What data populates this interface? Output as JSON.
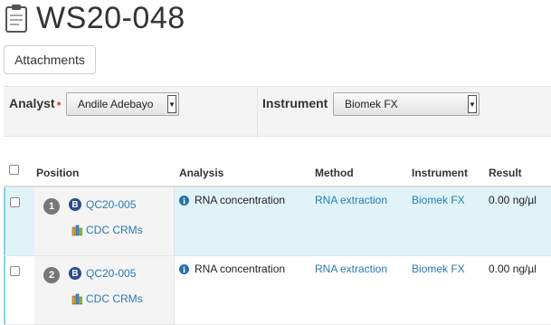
{
  "page": {
    "title": "WS20-048",
    "icon": "clipboard-icon"
  },
  "toolbar": {
    "attachments_label": "Attachments"
  },
  "filters": {
    "analyst_label": "Analyst",
    "analyst_required_marker": "•",
    "analyst_value": "Andile Adebayo",
    "instrument_label": "Instrument",
    "instrument_value": "Biomek FX"
  },
  "table": {
    "headers": {
      "position": "Position",
      "analysis": "Analysis",
      "method": "Method",
      "instrument": "Instrument",
      "result": "Result"
    },
    "rows": [
      {
        "position": "1",
        "sample": "QC20-005",
        "reference": "CDC CRMs",
        "analysis": "RNA concentration",
        "method": "RNA extraction",
        "instrument": "Biomek FX",
        "result": "0.00 ng/µl",
        "selected": true
      },
      {
        "position": "2",
        "sample": "QC20-005",
        "reference": "CDC CRMs",
        "analysis": "RNA concentration",
        "method": "RNA extraction",
        "instrument": "Biomek FX",
        "result": "0.00 ng/µl",
        "selected": false
      }
    ]
  },
  "colors": {
    "link": "#2a7ab3",
    "selected_row": "#dff3f9",
    "required": "#d9534f",
    "position_badge": "#777777",
    "b_badge": "#2a4c8f"
  }
}
